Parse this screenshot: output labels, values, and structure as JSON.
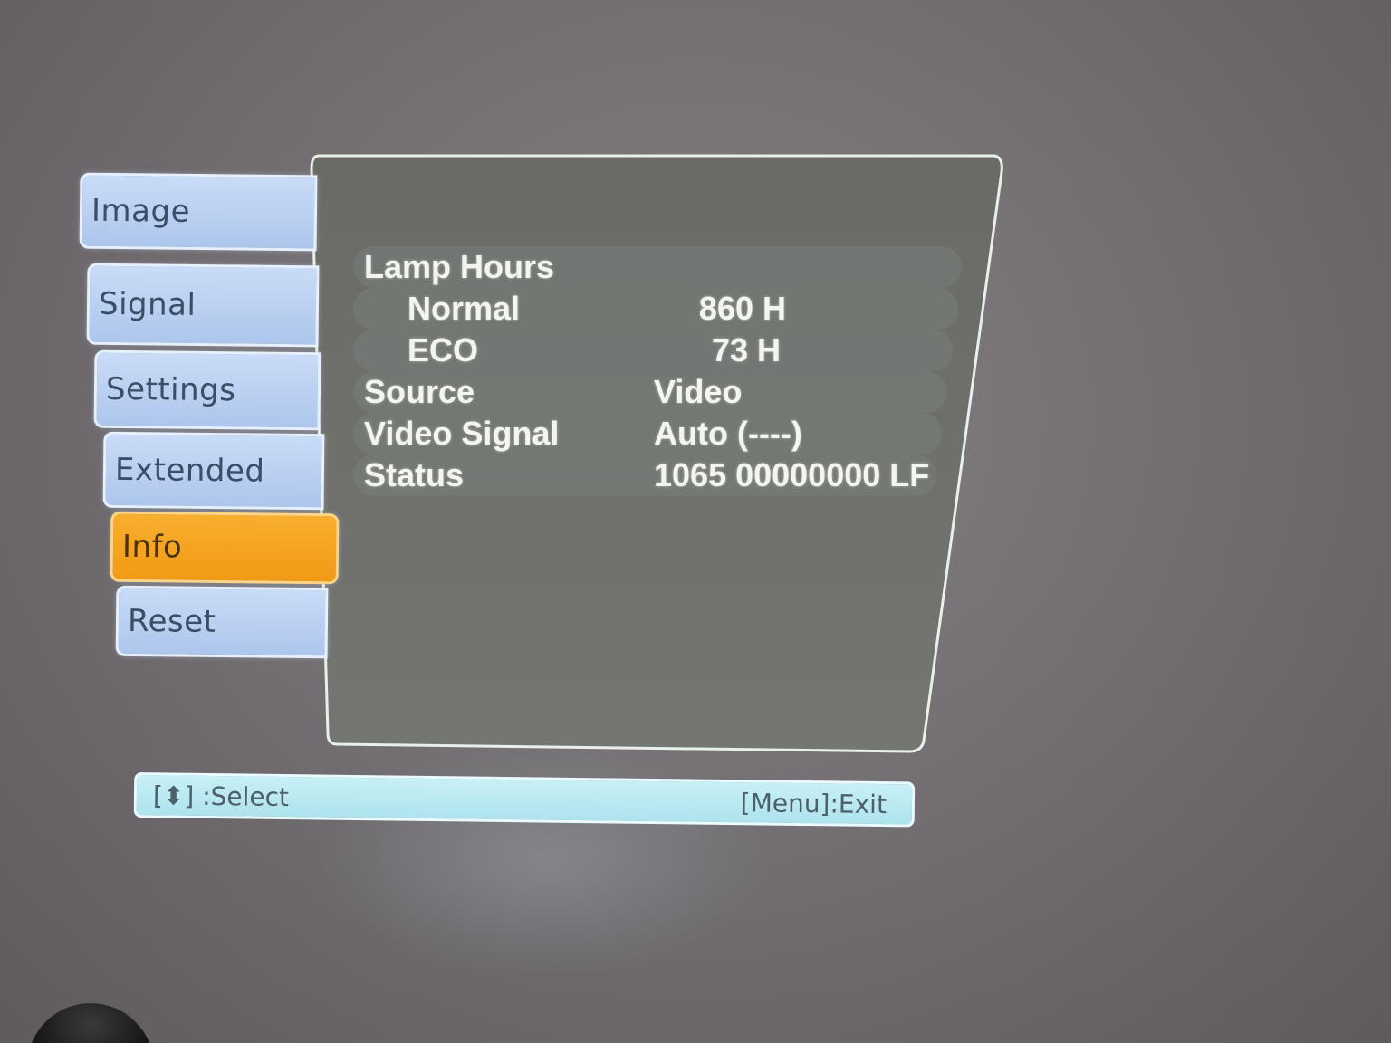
{
  "menu": {
    "tabs": [
      {
        "label": "Image"
      },
      {
        "label": "Signal"
      },
      {
        "label": "Settings"
      },
      {
        "label": "Extended"
      },
      {
        "label": "Info"
      },
      {
        "label": "Reset"
      }
    ],
    "active_tab": "Info"
  },
  "info": {
    "lamp_hours_label": "Lamp Hours",
    "normal_label": "Normal",
    "normal_value": "860 H",
    "eco_label": "ECO",
    "eco_value": "73 H",
    "source_label": "Source",
    "source_value": "Video",
    "video_signal_label": "Video Signal",
    "video_signal_value": "Auto (----)",
    "status_label": "Status",
    "status_value": "1065 00000000 LF"
  },
  "footer": {
    "select_hint": "[⬍] :Select",
    "exit_hint": "[Menu]:Exit"
  },
  "colors": {
    "tab_bg": "#adc6ec",
    "active_tab_bg": "#f29a16",
    "panel_bg": "#6b6b66",
    "footer_bg": "#aee3ee",
    "text": "#f2f6ee"
  }
}
